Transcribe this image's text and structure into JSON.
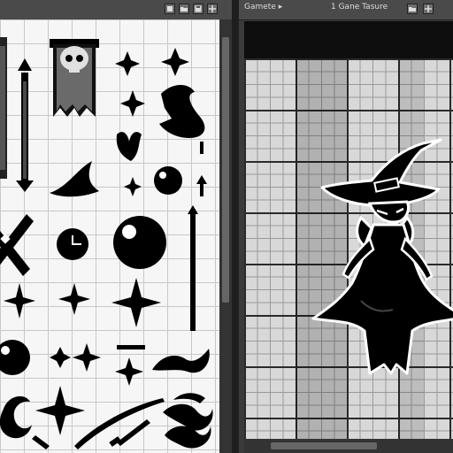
{
  "left_window": {
    "title": "",
    "icons": [
      "layers-icon",
      "folder-icon",
      "save-icon",
      "grid-icon"
    ]
  },
  "right_window": {
    "title": "Gamete ▸",
    "subtitle": "1 Gane Tasure",
    "icons": [
      "folder-icon",
      "grid-icon"
    ]
  },
  "colors": {
    "frame": "#3a3a3a",
    "canvas_light": "#f6f6f6",
    "sprite": "#000000",
    "dark_grid": "#2a2a2a"
  },
  "sprites": [
    "banner-skull-sprite",
    "star-sprite",
    "witch-hat-sprite",
    "sword-sprite",
    "crossed-swords-sprite",
    "bomb-sprite",
    "clock-sprite",
    "orb-sprite",
    "sparkle-sprite",
    "arrow-sprite",
    "wave-sprite",
    "swirl-sprite"
  ],
  "main_sprite": "witch-character-sprite"
}
